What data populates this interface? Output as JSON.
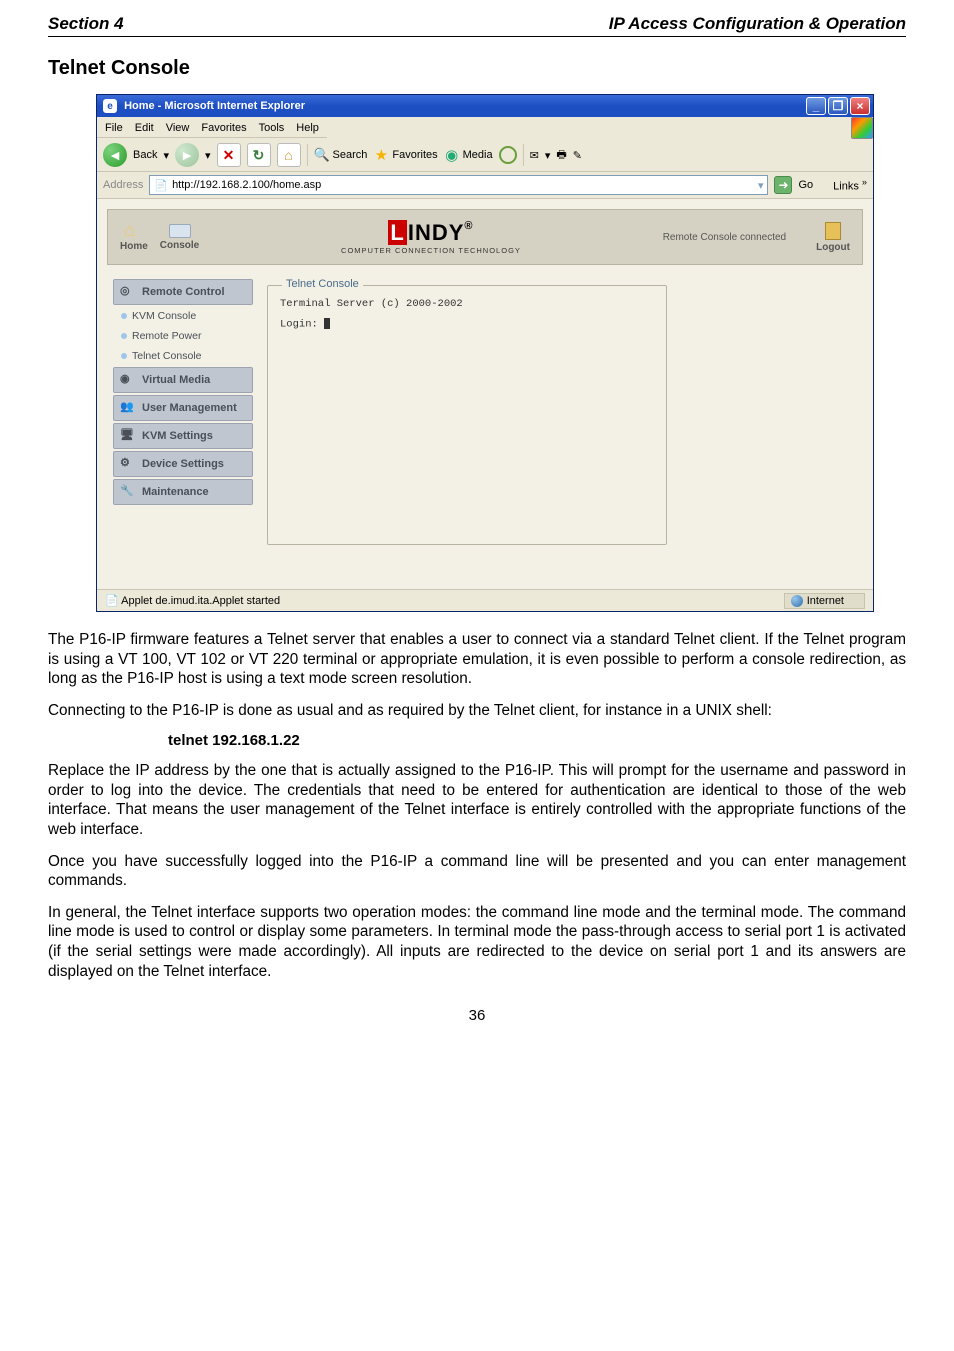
{
  "header": {
    "left": "Section 4",
    "right": "IP Access Configuration & Operation"
  },
  "title": "Telnet Console",
  "ie": {
    "title": "Home - Microsoft Internet Explorer",
    "menu": [
      "File",
      "Edit",
      "View",
      "Favorites",
      "Tools",
      "Help"
    ],
    "toolbar": {
      "back": "Back",
      "search": "Search",
      "favorites": "Favorites",
      "media": "Media"
    },
    "address_label": "Address",
    "url": "http://192.168.2.100/home.asp",
    "go": "Go",
    "links": "Links",
    "status_text": "Applet de.imud.ita.Applet started",
    "zone": "Internet"
  },
  "app": {
    "nav": {
      "home": "Home",
      "console": "Console"
    },
    "logo": {
      "brand": "LINDY",
      "tagline": "COMPUTER CONNECTION TECHNOLOGY",
      "reg": "®"
    },
    "status": "Remote Console connected",
    "logout": "Logout",
    "sidebar": {
      "remote_control": "Remote Control",
      "items": [
        "KVM Console",
        "Remote Power",
        "Telnet Console"
      ],
      "virtual_media": "Virtual Media",
      "user_mgmt": "User Management",
      "kvm_settings": "KVM Settings",
      "device_settings": "Device Settings",
      "maintenance": "Maintenance"
    },
    "panel": {
      "legend": "Telnet Console",
      "line1": "Terminal Server (c) 2000-2002",
      "login": "Login: "
    }
  },
  "paras": {
    "p1": "The P16-IP firmware features a Telnet server that enables a user to connect via a standard Telnet client. If the Telnet program is using a VT 100, VT 102 or VT 220 terminal or appropriate emulation, it is even possible to perform a console redirection, as long as the P16-IP host is using a text mode screen resolution.",
    "p2": "Connecting to the P16-IP is done as usual and as required by the Telnet client, for instance in a UNIX shell:",
    "cmd": "telnet 192.168.1.22",
    "p3": "Replace the IP address by the one that is actually assigned to the P16-IP. This will prompt for the username and password in order to log into the device. The credentials that need to be entered for authentication are identical to those of the web interface. That means the user management of the Telnet interface is entirely controlled with the appropriate functions of the web interface.",
    "p4": "Once you have successfully logged into the P16-IP a command line will be presented and you can enter management commands.",
    "p5": "In general, the Telnet interface supports two operation modes: the command line mode and the terminal mode. The command line mode is used to control or display some parameters. In terminal mode the pass-through access to serial port 1 is activated (if the serial settings were made accordingly). All inputs are redirected to the device on serial port 1 and its answers are displayed on the Telnet interface."
  },
  "page_number": "36"
}
